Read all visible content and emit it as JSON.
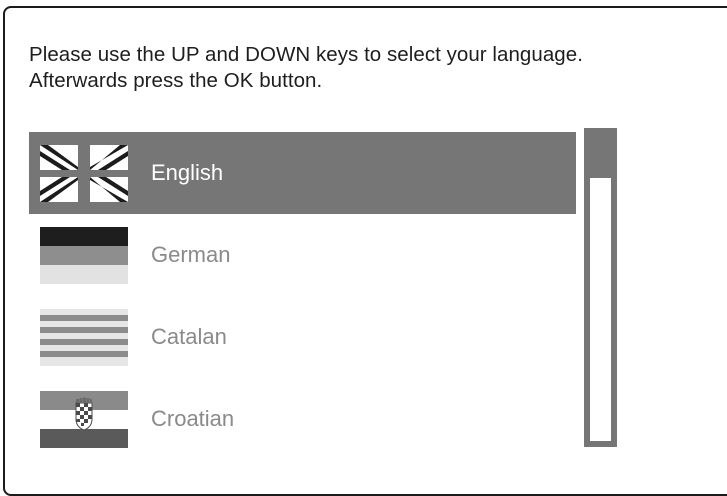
{
  "instructions": {
    "line1": "Please use the UP and DOWN keys to select your language.",
    "line2": "Afterwards press the OK button."
  },
  "languages": [
    {
      "label": "English",
      "flag_icon": "uk-flag-icon",
      "selected": true
    },
    {
      "label": "German",
      "flag_icon": "german-flag-icon",
      "selected": false
    },
    {
      "label": "Catalan",
      "flag_icon": "catalan-flag-icon",
      "selected": false
    },
    {
      "label": "Croatian",
      "flag_icon": "croatian-flag-icon",
      "selected": false
    }
  ],
  "colors": {
    "selection_bg": "#767676",
    "text_selected": "#ffffff",
    "text_normal": "#8a8a8a",
    "instruction_text": "#1e1e1e"
  }
}
